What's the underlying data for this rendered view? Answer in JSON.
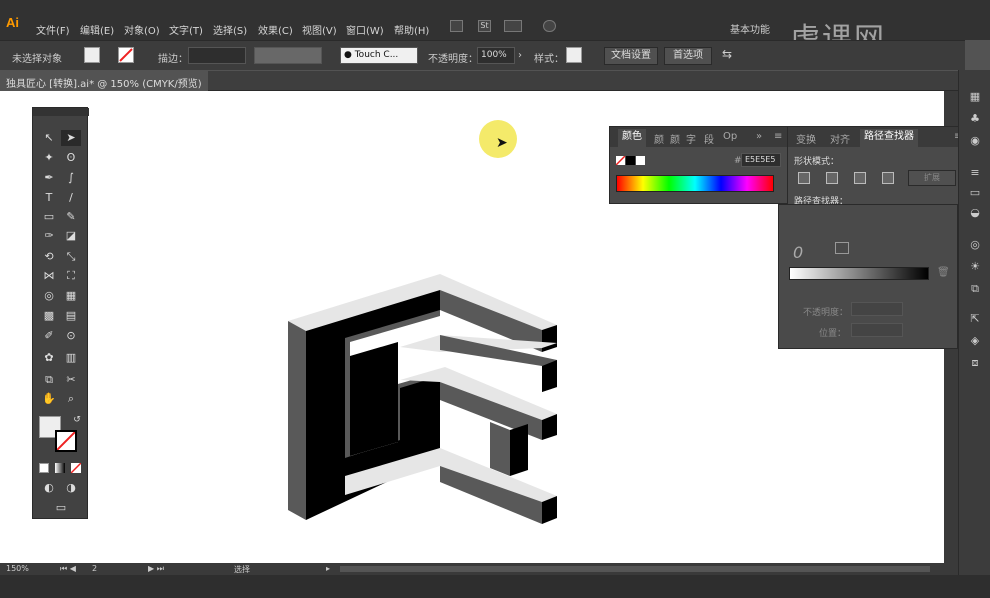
{
  "app": {
    "logo": "Ai"
  },
  "menu": [
    "文件(F)",
    "编辑(E)",
    "对象(O)",
    "文字(T)",
    "选择(S)",
    "效果(C)",
    "视图(V)",
    "窗口(W)",
    "帮助(H)"
  ],
  "workspace": "基本功能",
  "watermark": "虎课网",
  "control_bar": {
    "selection_label": "未选择对象",
    "stroke_label": "描边：",
    "brush_label": "Touch C...",
    "opacity_label": "不透明度：",
    "opacity_value": "100%",
    "style_label": "样式：",
    "doc_setup": "文档设置",
    "preferences": "首选项"
  },
  "doc_tab": "独具匠心 [转换].ai* @ 150% (CMYK/预览)",
  "status": {
    "zoom": "150%",
    "page": "2",
    "mode": "选择"
  },
  "color_panel": {
    "tab_active": "颜色",
    "tabs": [
      "颜",
      "颜",
      "字",
      "段",
      "Op"
    ],
    "hex_label": "#",
    "hex_value": "E5E5E5"
  },
  "pathfinder_panel": {
    "tabs": [
      "变换",
      "对齐"
    ],
    "tab_active": "路径查找器",
    "shape_modes_label": "形状模式：",
    "expand_label": "扩展",
    "pathfinders_label": "路径查找器："
  },
  "gradient_panel": {
    "opacity_label": "不透明度：",
    "position_label": "位置："
  },
  "colors": {
    "canvas": "#ffffff",
    "accent": "#ff9a00",
    "cursor": "#f3e85a"
  }
}
